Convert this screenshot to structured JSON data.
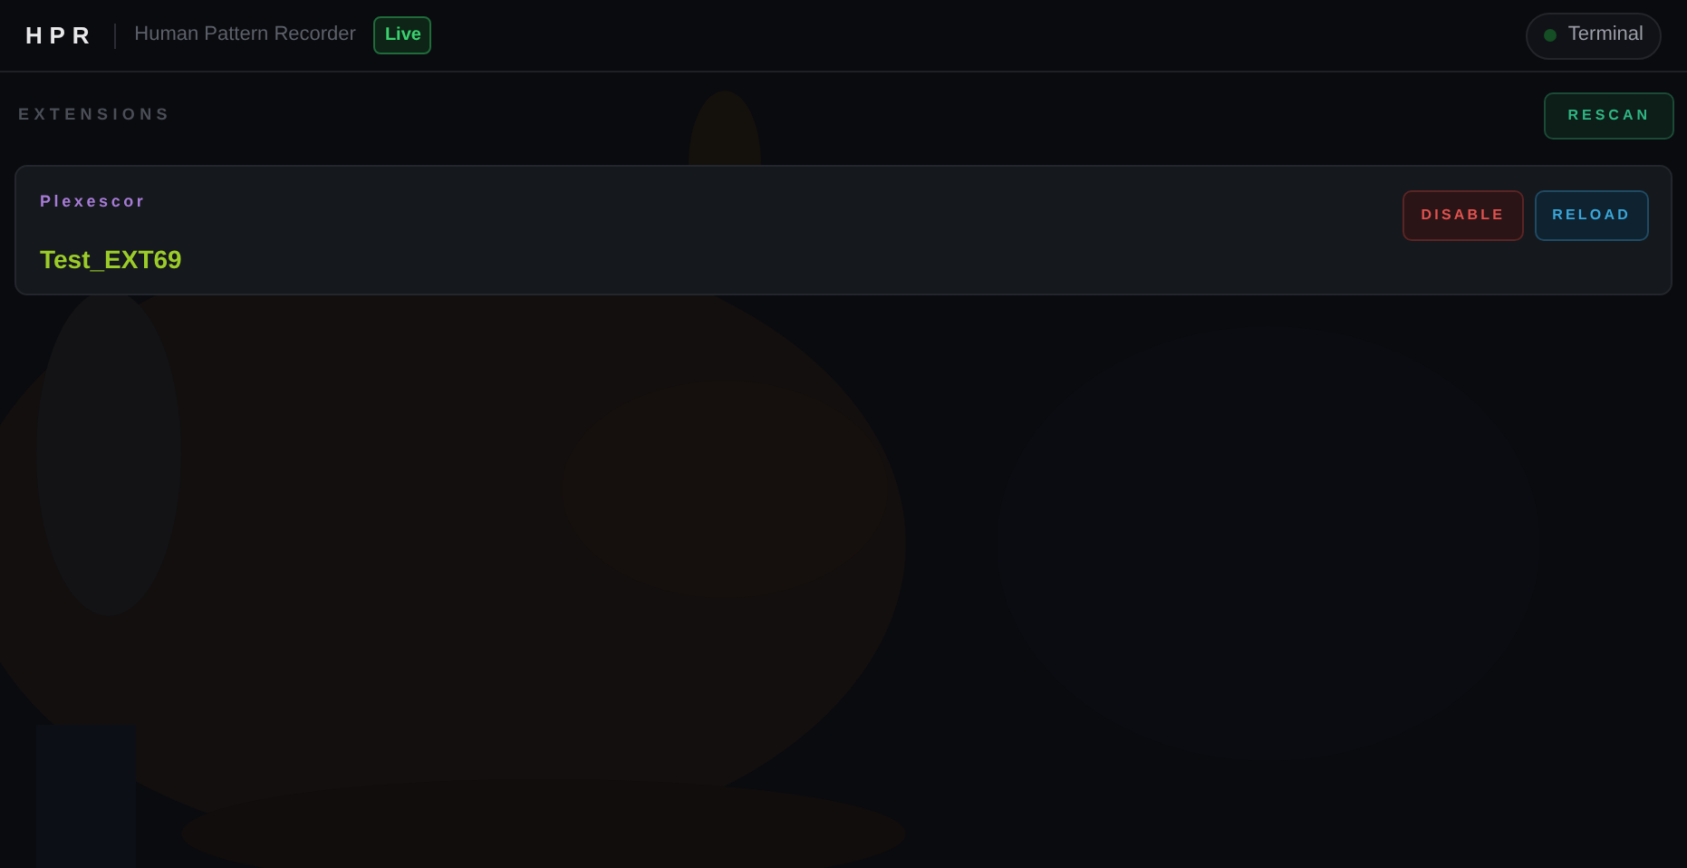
{
  "header": {
    "logo": "HPR",
    "subtitle": "Human Pattern Recorder",
    "badge": "Live",
    "terminal": {
      "label": "Terminal",
      "on": false
    }
  },
  "section": {
    "title": "EXTENSIONS",
    "action": "RESCAN"
  },
  "extensions": [
    {
      "author": "Plexescor",
      "name": "Test_EXT69",
      "buttons": [
        {
          "label": "DISABLE",
          "kind": "danger"
        },
        {
          "label": "RELOAD",
          "kind": "info"
        }
      ]
    }
  ]
}
